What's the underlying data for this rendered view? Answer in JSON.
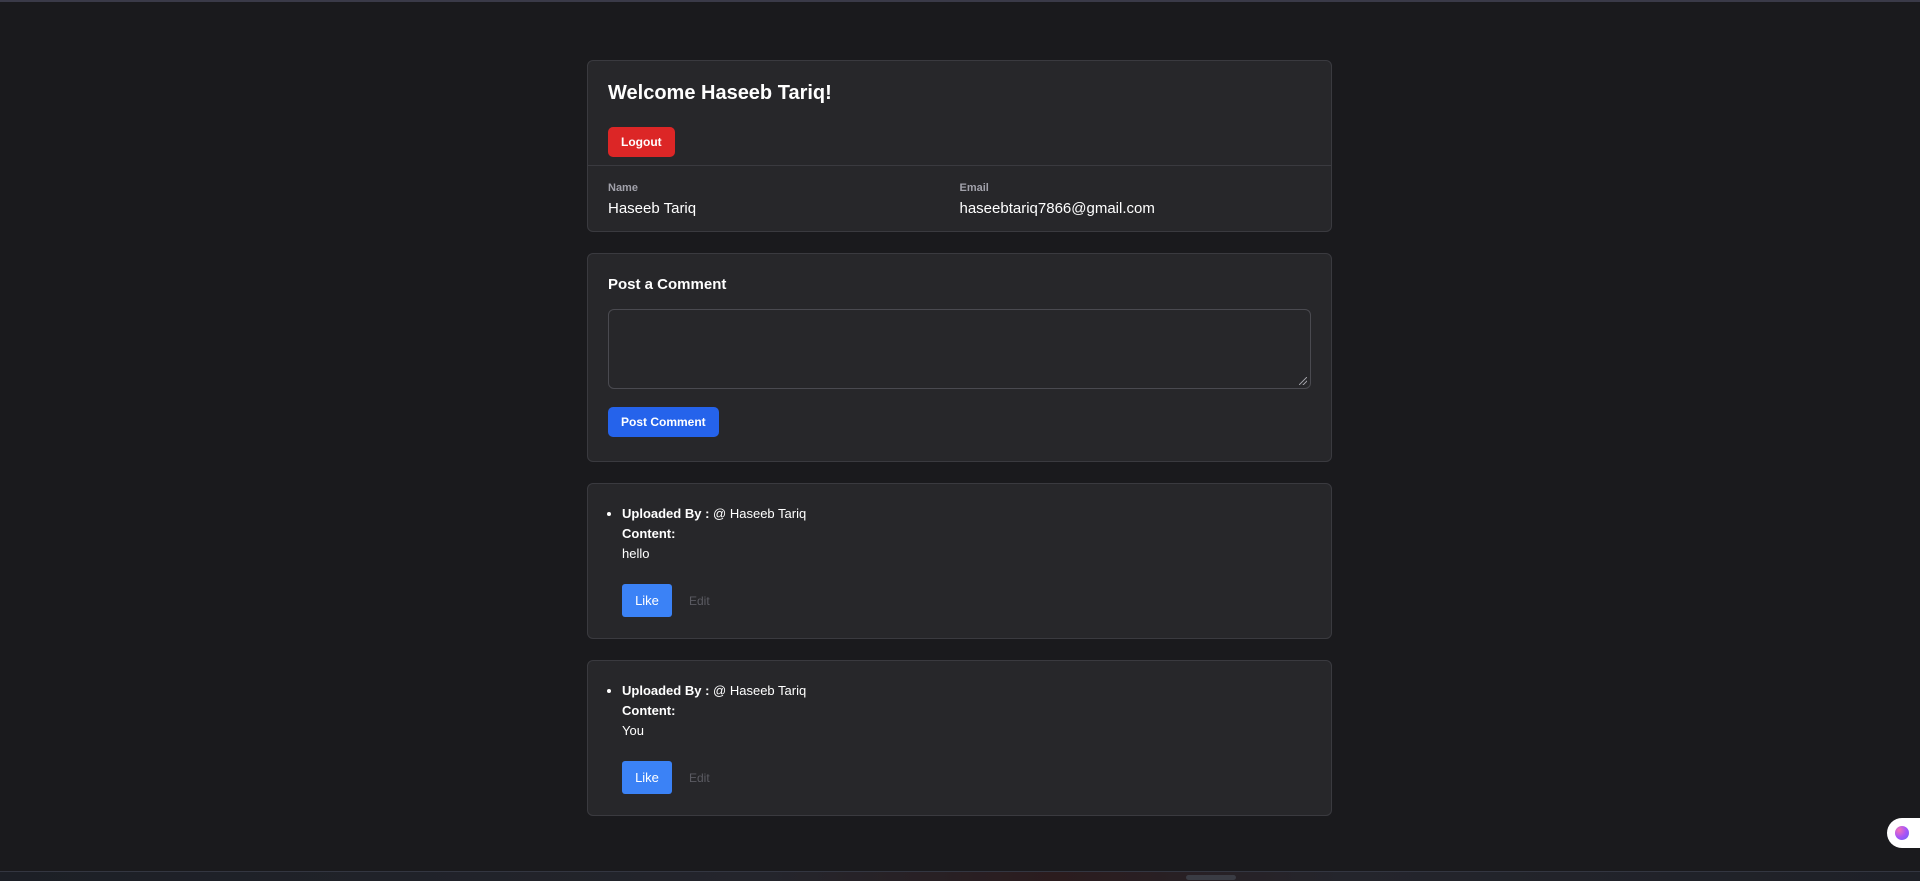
{
  "profile": {
    "welcome": "Welcome Haseeb Tariq!",
    "logout_label": "Logout",
    "name_label": "Name",
    "name_value": "Haseeb Tariq",
    "email_label": "Email",
    "email_value": "haseebtariq7866@gmail.com"
  },
  "post": {
    "title": "Post a Comment",
    "textarea_value": "",
    "button_label": "Post Comment"
  },
  "comments": [
    {
      "uploaded_by_label": "Uploaded By :",
      "author": "@ Haseeb Tariq",
      "content_label": "Content:",
      "content": "hello",
      "like_label": "Like",
      "edit_label": "Edit"
    },
    {
      "uploaded_by_label": "Uploaded By :",
      "author": "@ Haseeb Tariq",
      "content_label": "Content:",
      "content": "You",
      "like_label": "Like",
      "edit_label": "Edit"
    }
  ],
  "colors": {
    "background": "#1a1a1d",
    "card": "#27272a",
    "logout": "#dc2626",
    "post_button": "#2563eb",
    "like_button": "#3b82f6"
  },
  "icons": {
    "floating_button": "brain-icon"
  }
}
